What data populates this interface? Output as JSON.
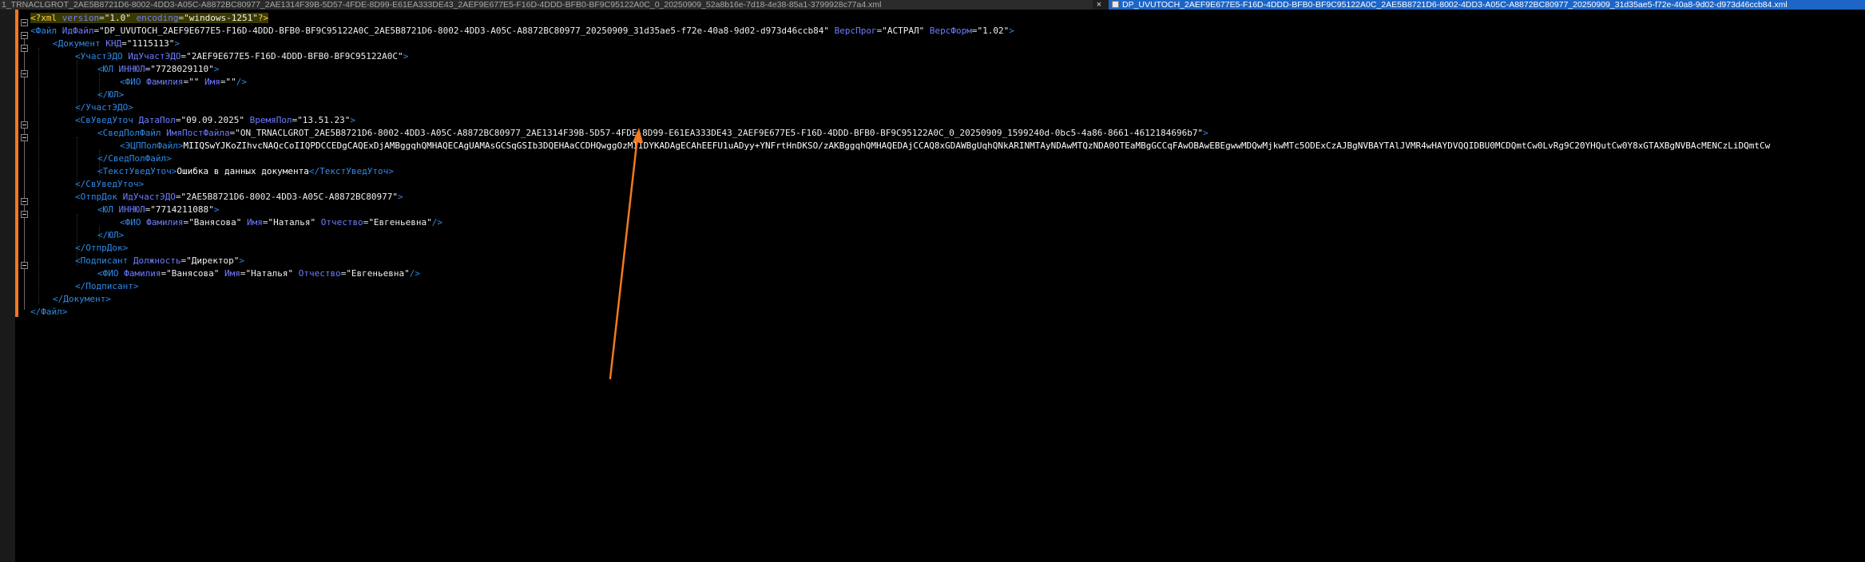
{
  "tabs": {
    "left_title": "1_TRNACLGROT_2AE5B8721D6-8002-4DD3-A05C-A8872BC80977_2AE1314F39B-5D57-4FDE-8D99-E61EA333DE43_2AEF9E677E5-F16D-4DDD-BFB0-BF9C95122A0C_0_20250909_52a8b16e-7d18-4e38-85a1-3799928c77a4.xml",
    "close_glyph": "×",
    "active_title": "DP_UVUTOCH_2AEF9E677E5-F16D-4DDD-BFB0-BF9C95122A0C_2AE5B8721D6-8002-4DD3-A05C-A8872BC80977_20250909_31d35ae5-f72e-40a8-9d02-d973d46ccb84.xml"
  },
  "xml": {
    "decl": {
      "open": "<?xml",
      "a1": "version",
      "v1": "\"1.0\"",
      "a2": "encoding",
      "v2": "\"windows-1251\"",
      "close": "?>"
    },
    "file": {
      "open": "<Файл",
      "a1": "ИдФайл",
      "v1": "\"DP_UVUTOCH_2AEF9E677E5-F16D-4DDD-BFB0-BF9C95122A0C_2AE5B8721D6-8002-4DD3-A05C-A8872BC80977_20250909_31d35ae5-f72e-40a8-9d02-d973d46ccb84\"",
      "a2": "ВерсПрог",
      "v2": "\"АСТРАЛ\"",
      "a3": "ВерсФорм",
      "v3": "\"1.02\"",
      "close": ">"
    },
    "doc": {
      "open": "<Документ",
      "a1": "КНД",
      "v1": "\"1115113\"",
      "close": ">"
    },
    "uchastedo": {
      "open": "<УчастЭДО",
      "a1": "ИдУчастЭДО",
      "v1": "\"2AEF9E677E5-F16D-4DDD-BFB0-BF9C95122A0C\"",
      "close": ">"
    },
    "yul1": {
      "open": "<ЮЛ",
      "a1": "ИННЮЛ",
      "v1": "\"7728029110\"",
      "close": ">"
    },
    "fio1": {
      "open": "<ФИО",
      "a1": "Фамилия",
      "v1": "\"\"",
      "a2": "Имя",
      "v2": "\"\"",
      "close": "/>"
    },
    "yul1_close": "</ЮЛ>",
    "uchastedo_close": "</УчастЭДО>",
    "svuved": {
      "open": "<СвУведУточ",
      "a1": "ДатаПол",
      "v1": "\"09.09.2025\"",
      "a2": "ВремяПол",
      "v2": "\"13.51.23\"",
      "close": ">"
    },
    "svedpol": {
      "open": "<СведПолФайл",
      "a1": "ИмяПостФайла",
      "v1": "\"ON_TRNACLGROT_2AE5B8721D6-8002-4DD3-A05C-A8872BC80977_2AE1314F39B-5D57-4FDE-8D99-E61EA333DE43_2AEF9E677E5-F16D-4DDD-BFB0-BF9C95122A0C_0_20250909_1599240d-0bc5-4a86-8661-4612184696b7\"",
      "close": ">"
    },
    "ecp": {
      "open": "<ЭЦППолФайл>",
      "text": "MIIQSwYJKoZIhvcNAQcCoIIQPDCCEDgCAQExDjAMBggqhQMHAQECAgUAMAsGCSqGSIb3DQEHAaCCDHQwggOzMIIDYKADAgECAhEEFU1uADyy+YNFrtHnDKSO/zAKBggqhQMHAQEDAjCCAQ8xGDAWBgUqhQNkARINMTAyNDAwMTQzNDA0OTEaMBgGCCqFAwOBAwEBEgwwMDQwMjkwMTc5ODExCzAJBgNVBAYTAlJVMR4wHAYDVQQIDBU0MCDQmtCw0LvRg9C20YHQutCw0Y8xGTAXBgNVBAcMENCzLiDQmtCw"
    },
    "svedpol_close": "</СведПолФайл>",
    "tekst": {
      "open": "<ТекстУведУточ>",
      "text": "Ошибка в данных документа",
      "close": "</ТекстУведУточ>"
    },
    "svuved_close": "</СвУведУточ>",
    "otprdok": {
      "open": "<ОтпрДок",
      "a1": "ИдУчастЭДО",
      "v1": "\"2AE5B8721D6-8002-4DD3-A05C-A8872BC80977\"",
      "close": ">"
    },
    "yul2": {
      "open": "<ЮЛ",
      "a1": "ИННЮЛ",
      "v1": "\"7714211088\"",
      "close": ">"
    },
    "fio2": {
      "open": "<ФИО",
      "a1": "Фамилия",
      "v1": "\"Ванясова\"",
      "a2": "Имя",
      "v2": "\"Наталья\"",
      "a3": "Отчество",
      "v3": "\"Евгеньевна\"",
      "close": "/>"
    },
    "yul2_close": "</ЮЛ>",
    "otprdok_close": "</ОтпрДок>",
    "podpisant": {
      "open": "<Подписант",
      "a1": "Должность",
      "v1": "\"Директор\"",
      "close": ">"
    },
    "fio3": {
      "open": "<ФИО",
      "a1": "Фамилия",
      "v1": "\"Ванясова\"",
      "a2": "Имя",
      "v2": "\"Наталья\"",
      "a3": "Отчество",
      "v3": "\"Евгеньевна\"",
      "close": "/>"
    },
    "podpisant_close": "</Подписант>",
    "doc_close": "</Документ>",
    "file_close": "</Файл>"
  },
  "colors": {
    "accent_tab": "#1d66c8",
    "change_bar": "#f47920",
    "arrow": "#f47920"
  }
}
